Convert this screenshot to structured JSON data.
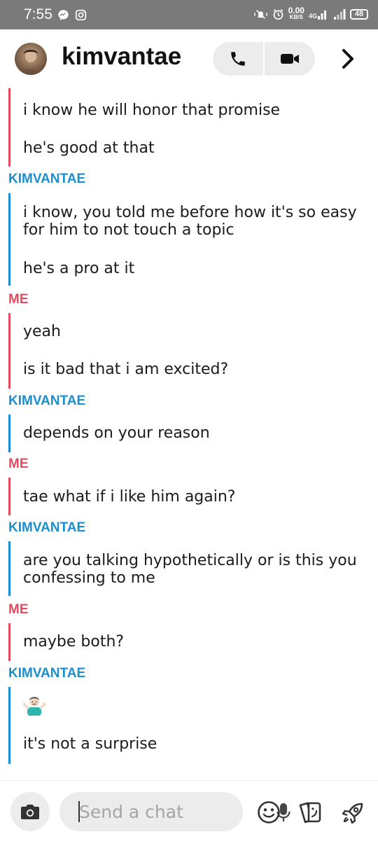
{
  "status_bar": {
    "time": "7:55",
    "net_speed_value": "0.00",
    "net_speed_unit": "KB/S",
    "network_type": "4G",
    "battery": "48"
  },
  "header": {
    "title": "kimvantae"
  },
  "messages": [
    {
      "text": "i know he will honor that promise"
    },
    {
      "text": "he's good at that"
    },
    {
      "sender": "KIMVANTAE"
    },
    {
      "text": "i know, you told me before how it's so easy for him to not touch a topic"
    },
    {
      "text": "he's a pro at it"
    },
    {
      "sender": "ME"
    },
    {
      "text": "yeah"
    },
    {
      "text": "is it bad that i am excited?"
    },
    {
      "sender": "KIMVANTAE"
    },
    {
      "text": "depends on your reason"
    },
    {
      "sender": "ME"
    },
    {
      "text": "tae what if i like him again?"
    },
    {
      "sender": "KIMVANTAE"
    },
    {
      "text": "are you talking hypothetically or is this you confessing to me"
    },
    {
      "sender": "ME"
    },
    {
      "text": "maybe both?"
    },
    {
      "sender": "KIMVANTAE"
    },
    {
      "emoji": "person-shrugging"
    },
    {
      "text": "it's not a surprise"
    }
  ],
  "composer": {
    "placeholder": "Send a chat"
  },
  "colors": {
    "friend_accent": "#1a8fcf",
    "me_accent": "#e54b5f",
    "status_bar_bg": "#7a7a7a"
  }
}
